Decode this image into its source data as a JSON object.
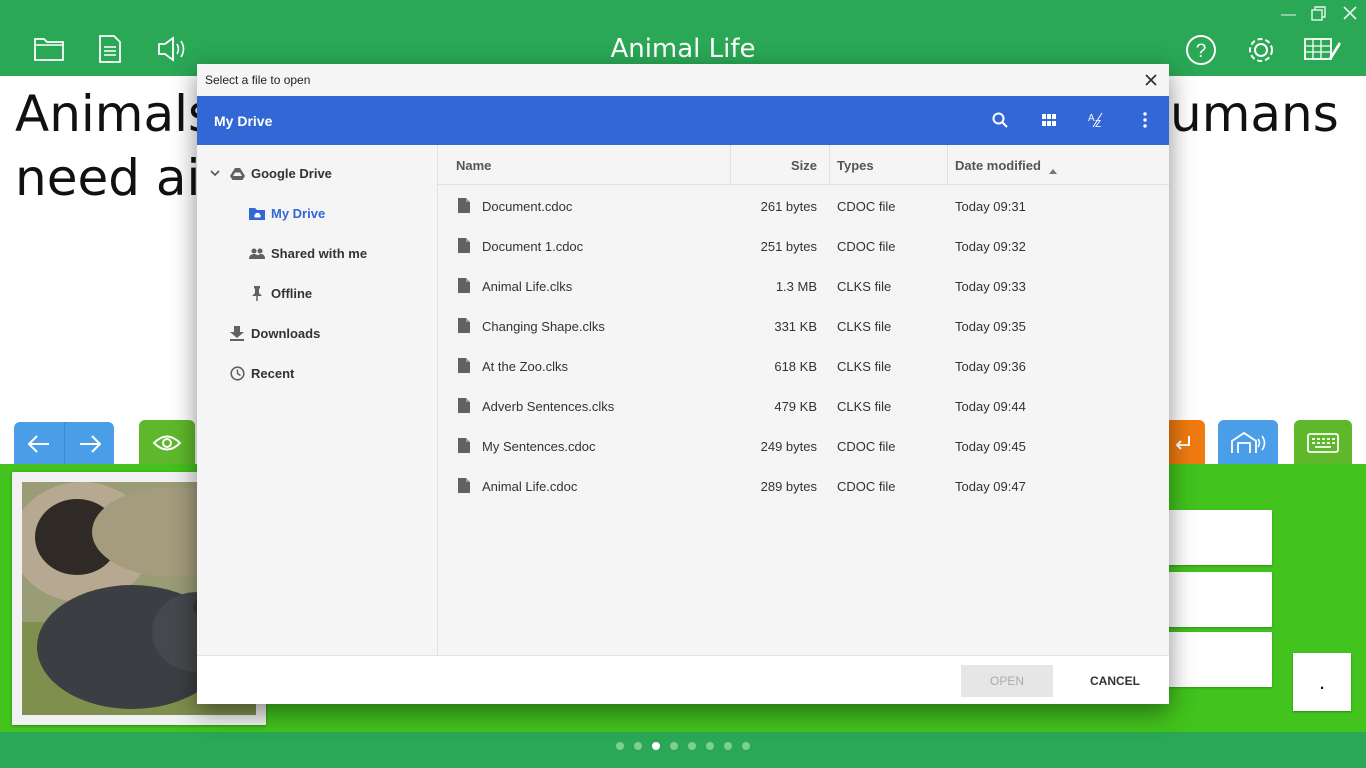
{
  "app": {
    "title": "Animal Life",
    "sentence_left_1": "Animals",
    "sentence_left_2": "need air",
    "sentence_right": "umans",
    "period": ".",
    "page_count": 8,
    "active_page": 3
  },
  "dialog": {
    "window_title": "Select a file to open",
    "location": "My Drive",
    "sidebar": [
      {
        "label": "Google Drive",
        "icon": "drive-icon",
        "expanded": true
      },
      {
        "label": "My Drive",
        "icon": "folder-drive-icon",
        "selected": true
      },
      {
        "label": "Shared with me",
        "icon": "people-icon"
      },
      {
        "label": "Offline",
        "icon": "pin-icon"
      },
      {
        "label": "Downloads",
        "icon": "download-icon"
      },
      {
        "label": "Recent",
        "icon": "clock-icon"
      }
    ],
    "columns": {
      "name": "Name",
      "size": "Size",
      "type": "Types",
      "date": "Date modified"
    },
    "files": [
      {
        "name": "Document.cdoc",
        "size": "261 bytes",
        "type": "CDOC file",
        "date": "Today 09:31"
      },
      {
        "name": "Document 1.cdoc",
        "size": "251 bytes",
        "type": "CDOC file",
        "date": "Today 09:32"
      },
      {
        "name": "Animal Life.clks",
        "size": "1.3 MB",
        "type": "CLKS file",
        "date": "Today 09:33"
      },
      {
        "name": "Changing Shape.clks",
        "size": "331 KB",
        "type": "CLKS file",
        "date": "Today 09:35"
      },
      {
        "name": "At the Zoo.clks",
        "size": "618 KB",
        "type": "CLKS file",
        "date": "Today 09:36"
      },
      {
        "name": "Adverb Sentences.clks",
        "size": "479 KB",
        "type": "CLKS file",
        "date": "Today 09:44"
      },
      {
        "name": "My Sentences.cdoc",
        "size": "249 bytes",
        "type": "CDOC file",
        "date": "Today 09:45"
      },
      {
        "name": "Animal Life.cdoc",
        "size": "289 bytes",
        "type": "CDOC file",
        "date": "Today 09:47"
      }
    ],
    "open_label": "OPEN",
    "cancel_label": "CANCEL"
  },
  "colors": {
    "header_blue": "#3367d6",
    "app_green": "#2aa855",
    "grid_green": "#42c31d"
  }
}
